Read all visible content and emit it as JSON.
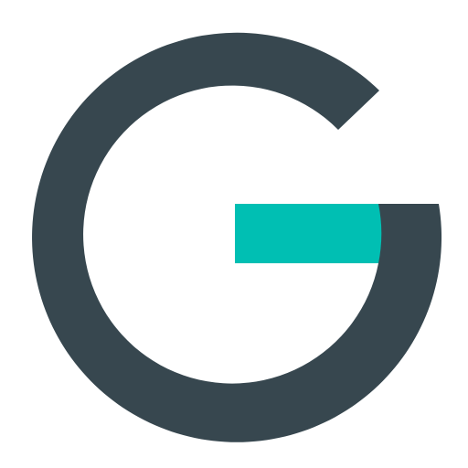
{
  "icon": {
    "name": "G logo",
    "colors": {
      "background": "#ffffff",
      "ring": "#37474f",
      "accent_bar": "#00bfb3"
    }
  }
}
